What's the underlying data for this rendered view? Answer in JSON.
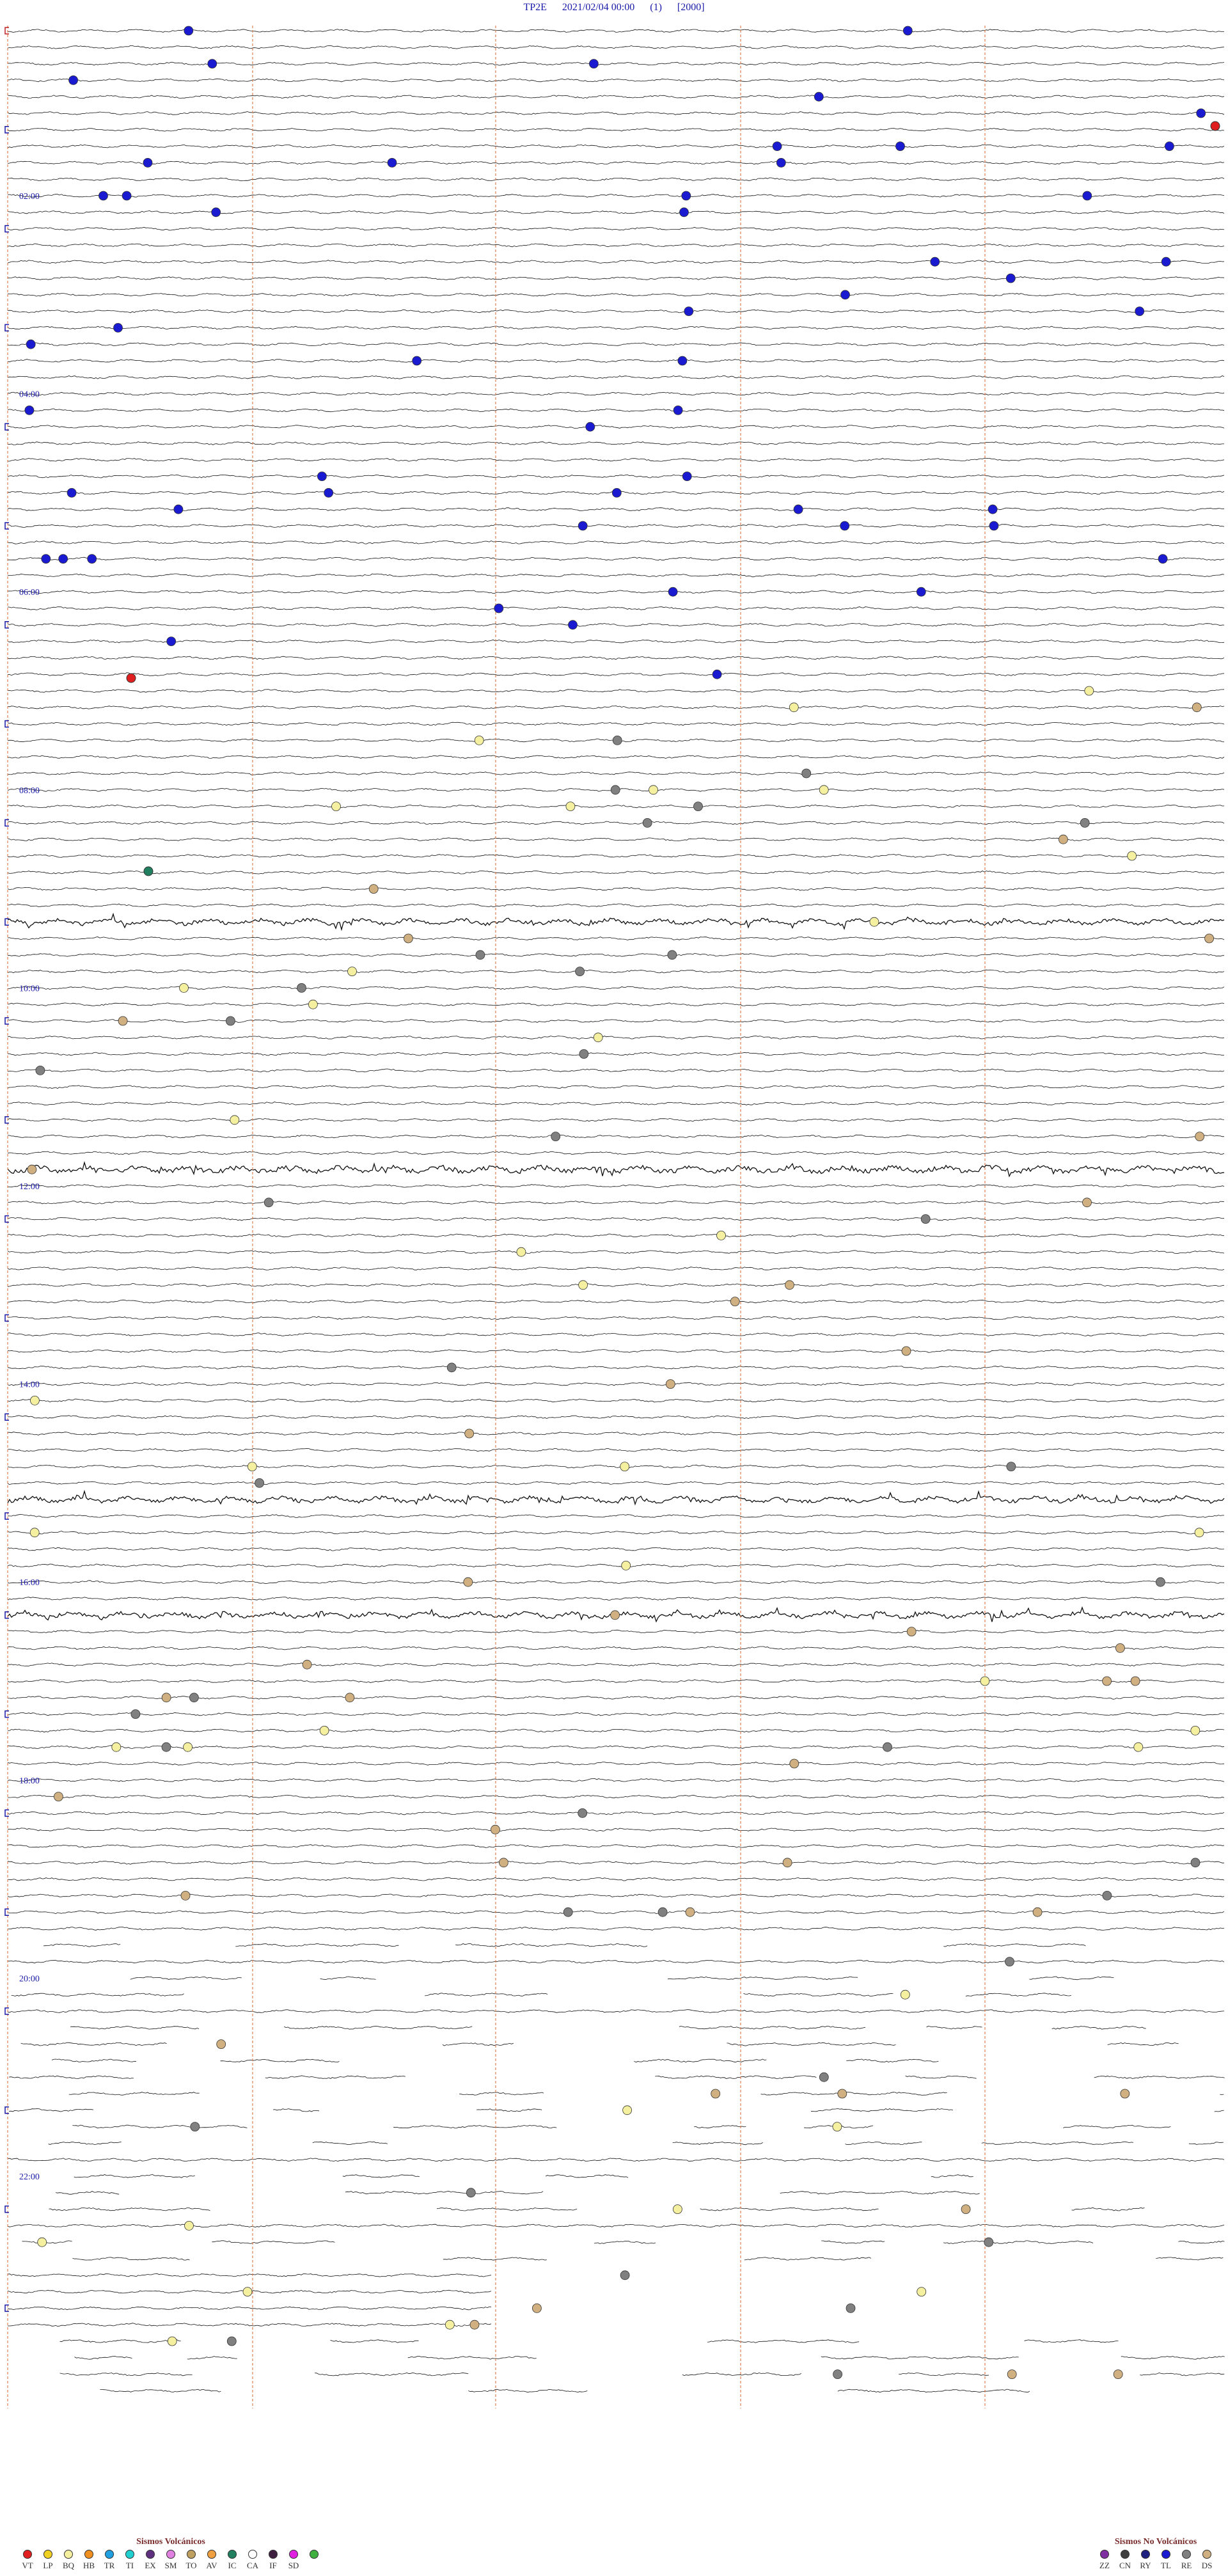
{
  "header": {
    "station": "TP2E",
    "datetime": "2021/02/04 00:00",
    "channel": "(1)",
    "scale": "[2000]"
  },
  "hour_labels": [
    "02:00",
    "04:00",
    "06:00",
    "08:00",
    "10:00",
    "12:00",
    "14:00",
    "16:00",
    "18:00",
    "20:00",
    "22:00"
  ],
  "legend_volcanic": {
    "title": "Sismos Volcánicos",
    "items": [
      {
        "code": "VT",
        "color": "#e02020"
      },
      {
        "code": "LP",
        "color": "#f0d020"
      },
      {
        "code": "BQ",
        "color": "#f4f0a0"
      },
      {
        "code": "HB",
        "color": "#f09020"
      },
      {
        "code": "TR",
        "color": "#20a0e0"
      },
      {
        "code": "TI",
        "color": "#20d0d0"
      },
      {
        "code": "EX",
        "color": "#603080"
      },
      {
        "code": "SM",
        "color": "#e080e0"
      },
      {
        "code": "TO",
        "color": "#c0a060"
      },
      {
        "code": "AV",
        "color": "#f0a040"
      },
      {
        "code": "IC",
        "color": "#208060"
      },
      {
        "code": "CA",
        "color": "#ffffff"
      },
      {
        "code": "IF",
        "color": "#402040"
      },
      {
        "code": "SD",
        "color": "#e020e0"
      },
      {
        "code": "",
        "color": "#40b040"
      }
    ]
  },
  "legend_nonvolcanic": {
    "title": "Sismos No Volcánicos",
    "items": [
      {
        "code": "ZZ",
        "color": "#8030a0"
      },
      {
        "code": "CN",
        "color": "#404040"
      },
      {
        "code": "RY",
        "color": "#202080"
      },
      {
        "code": "TL",
        "color": "#1a1ad0"
      },
      {
        "code": "RE",
        "color": "#808080"
      },
      {
        "code": "DS",
        "color": "#d0b080"
      }
    ]
  }
}
